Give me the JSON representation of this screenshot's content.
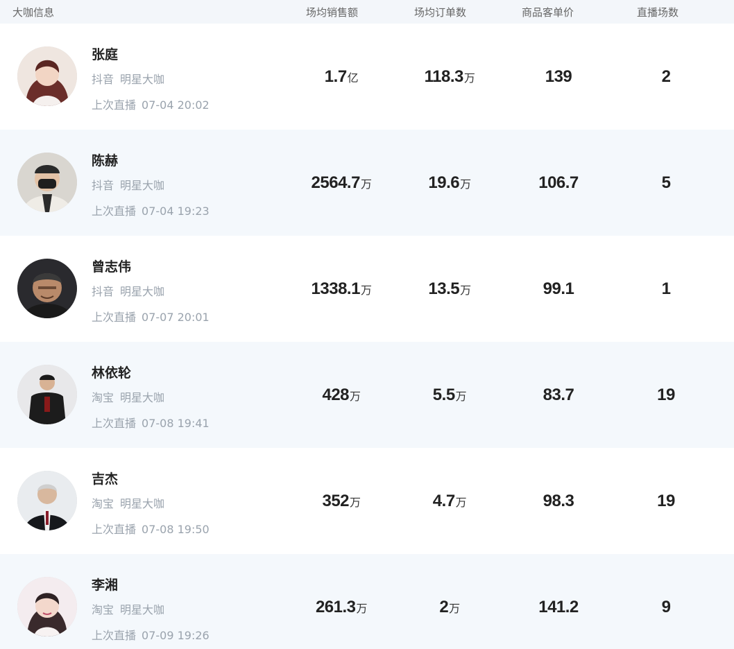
{
  "header": {
    "info": "大咖信息",
    "sales": "场均销售额",
    "orders": "场均订单数",
    "price": "商品客单价",
    "count": "直播场数"
  },
  "rows": [
    {
      "name": "张庭",
      "platform": "抖音",
      "tag": "明星大咖",
      "last_label": "上次直播",
      "last_time": "07-04 20:02",
      "sales": "1.7",
      "sales_unit": "亿",
      "orders": "118.3",
      "orders_unit": "万",
      "price": "139",
      "count": "2"
    },
    {
      "name": "陈赫",
      "platform": "抖音",
      "tag": "明星大咖",
      "last_label": "上次直播",
      "last_time": "07-04 19:23",
      "sales": "2564.7",
      "sales_unit": "万",
      "orders": "19.6",
      "orders_unit": "万",
      "price": "106.7",
      "count": "5"
    },
    {
      "name": "曾志伟",
      "platform": "抖音",
      "tag": "明星大咖",
      "last_label": "上次直播",
      "last_time": "07-07 20:01",
      "sales": "1338.1",
      "sales_unit": "万",
      "orders": "13.5",
      "orders_unit": "万",
      "price": "99.1",
      "count": "1"
    },
    {
      "name": "林依轮",
      "platform": "淘宝",
      "tag": "明星大咖",
      "last_label": "上次直播",
      "last_time": "07-08 19:41",
      "sales": "428",
      "sales_unit": "万",
      "orders": "5.5",
      "orders_unit": "万",
      "price": "83.7",
      "count": "19"
    },
    {
      "name": "吉杰",
      "platform": "淘宝",
      "tag": "明星大咖",
      "last_label": "上次直播",
      "last_time": "07-08 19:50",
      "sales": "352",
      "sales_unit": "万",
      "orders": "4.7",
      "orders_unit": "万",
      "price": "98.3",
      "count": "19"
    },
    {
      "name": "李湘",
      "platform": "淘宝",
      "tag": "明星大咖",
      "last_label": "上次直播",
      "last_time": "07-09 19:26",
      "sales": "261.3",
      "sales_unit": "万",
      "orders": "2",
      "orders_unit": "万",
      "price": "141.2",
      "count": "9"
    }
  ]
}
